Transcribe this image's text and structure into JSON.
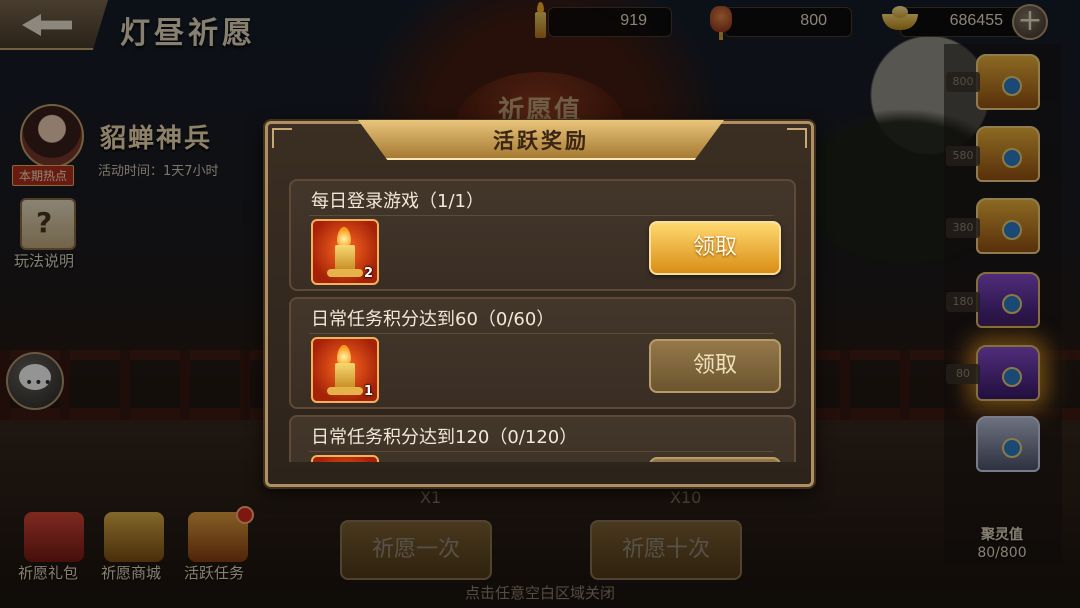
{
  "header": {
    "title": "灯昼祈愿",
    "candles": "919",
    "lanterns": "800",
    "gold": "686455"
  },
  "event": {
    "name": "貂蝉神兵",
    "time": "活动时间：1天7小时",
    "hot_tag": "本期热点",
    "background_label": "祈愿值"
  },
  "sidebar": {
    "rules_label": "玩法说明"
  },
  "bottom": {
    "gift_label": "祈愿礼包",
    "shop_label": "祈愿商城",
    "task_label": "活跃任务",
    "pray_once": "祈愿一次",
    "pray_ten": "祈愿十次",
    "mult_once": "X1",
    "mult_ten": "X10",
    "close_hint": "点击任意空白区域关闭"
  },
  "chests": [
    {
      "threshold": "800"
    },
    {
      "threshold": "580"
    },
    {
      "threshold": "380"
    },
    {
      "threshold": "180"
    },
    {
      "threshold": "80"
    }
  ],
  "gather": {
    "label": "聚灵值",
    "value": "80/800"
  },
  "modal": {
    "title": "活跃奖励",
    "tasks": [
      {
        "title": "每日登录游戏（1/1）",
        "reward_qty": "2",
        "button": "领取",
        "claimable": true
      },
      {
        "title": "日常任务积分达到60（0/60）",
        "reward_qty": "1",
        "button": "领取",
        "claimable": false
      },
      {
        "title": "日常任务积分达到120（0/120）",
        "reward_qty": "",
        "button": "",
        "claimable": false
      }
    ]
  },
  "colors": {
    "accent_gold": "#d98e16",
    "panel_bg": "#3b2e23",
    "border": "#b09062"
  }
}
